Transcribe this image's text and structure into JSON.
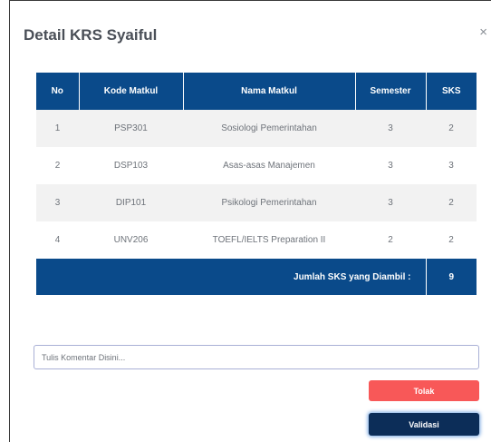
{
  "modal": {
    "title": "Detail KRS Syaiful",
    "close_label": "×"
  },
  "table": {
    "headers": [
      "No",
      "Kode Matkul",
      "Nama Matkul",
      "Semester",
      "SKS"
    ],
    "rows": [
      [
        "1",
        "PSP301",
        "Sosiologi Pemerintahan",
        "3",
        "2"
      ],
      [
        "2",
        "DSP103",
        "Asas-asas Manajemen",
        "3",
        "3"
      ],
      [
        "3",
        "DIP101",
        "Psikologi Pemerintahan",
        "3",
        "2"
      ],
      [
        "4",
        "UNV206",
        "TOEFL/IELTS Preparation II",
        "2",
        "2"
      ]
    ],
    "total_label": "Jumlah SKS yang Diambil :",
    "total_value": "9"
  },
  "comment": {
    "placeholder": "Tulis Komentar Disini..."
  },
  "actions": {
    "reject_label": "Tolak",
    "validate_label": "Validasi"
  },
  "colors": {
    "header_bg": "#0a4a8a",
    "reject": "#f85858",
    "validate": "#0c2d58"
  }
}
